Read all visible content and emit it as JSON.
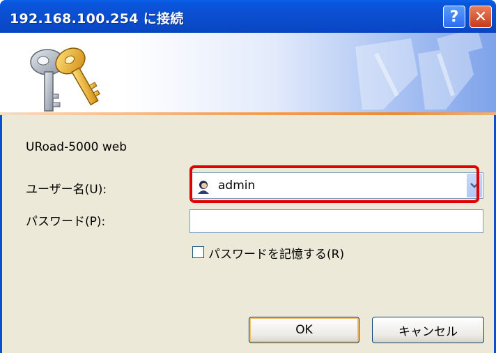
{
  "window": {
    "title": "192.168.100.254 に接続",
    "help_label": "?",
    "close_label": "✕"
  },
  "form": {
    "realm": "URoad-5000 web",
    "username_label": "ユーザー名(U):",
    "username_value": "admin",
    "password_label": "パスワード(P):",
    "password_value": "",
    "remember_label": "パスワードを記憶する(R)",
    "remember_checked": false
  },
  "buttons": {
    "ok": "OK",
    "cancel": "キャンセル"
  },
  "icons": {
    "banner": "keys-icon",
    "user": "user-icon",
    "dropdown": "chevron-down-icon"
  },
  "colors": {
    "title_bar": "#0b4fd2",
    "highlight": "#e00000",
    "dialog_bg": "#ece9d8"
  }
}
